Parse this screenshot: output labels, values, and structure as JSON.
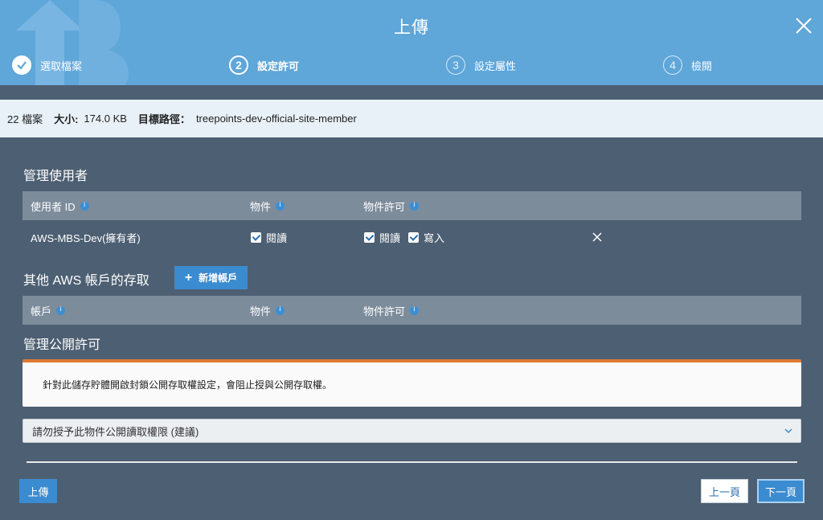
{
  "header": {
    "title": "上傳",
    "steps": [
      {
        "number": "✓",
        "label": "選取檔案",
        "state": "done"
      },
      {
        "number": "2",
        "label": "設定許可",
        "state": "active"
      },
      {
        "number": "3",
        "label": "設定屬性",
        "state": "pending"
      },
      {
        "number": "4",
        "label": "檢閱",
        "state": "pending"
      }
    ]
  },
  "infobar": {
    "file_count": "22 檔案",
    "size_label": "大小:",
    "size_value": "174.0 KB",
    "target_label": "目標路徑：",
    "target_value": "treepoints-dev-official-site-member"
  },
  "manage_users": {
    "title": "管理使用者",
    "columns": [
      "使用者 ID",
      "物件",
      "物件許可"
    ],
    "rows": [
      {
        "user": "AWS-MBS-Dev(擁有者)",
        "object_read": "閱讀",
        "perm_read": "閱讀",
        "perm_write": "寫入"
      }
    ]
  },
  "other_accounts": {
    "title": "其他 AWS 帳戶的存取",
    "add_button": "新增帳戶",
    "columns": [
      "帳戶",
      "物件",
      "物件許可"
    ]
  },
  "public": {
    "title": "管理公開許可",
    "warning": "針對此儲存貯體開啟封鎖公開存取權設定，會阻止授與公開存取權。",
    "select_value": "請勿授予此物件公開讀取權限 (建議)"
  },
  "footer": {
    "upload": "上傳",
    "prev": "上一頁",
    "next": "下一頁"
  },
  "colors": {
    "header_bg": "#5fa6d9",
    "body_bg": "#4d5f72",
    "primary_button": "#3b8bd0",
    "warning_accent": "#e0782f"
  }
}
